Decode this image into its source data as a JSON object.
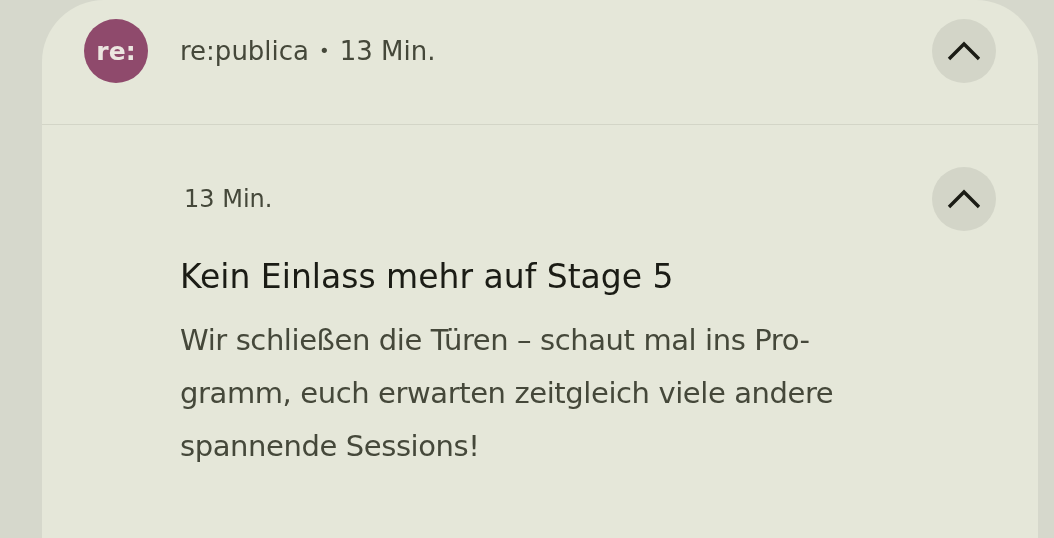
{
  "notification": {
    "app": {
      "avatar": "re:",
      "color": "#8f4a6c",
      "name": "re:publica",
      "separator": "•",
      "time": "13 Min.",
      "expanded": true
    },
    "messages": [
      {
        "time": "13 Min.",
        "expanded": true,
        "title": "Kein Einlass mehr auf Stage 5",
        "body_lines": [
          "Wir schließen die Türen – schaut mal ins Pro-",
          "gramm, euch erwarten zeitgleich viele andere",
          "spannende Sessions!"
        ]
      }
    ]
  }
}
